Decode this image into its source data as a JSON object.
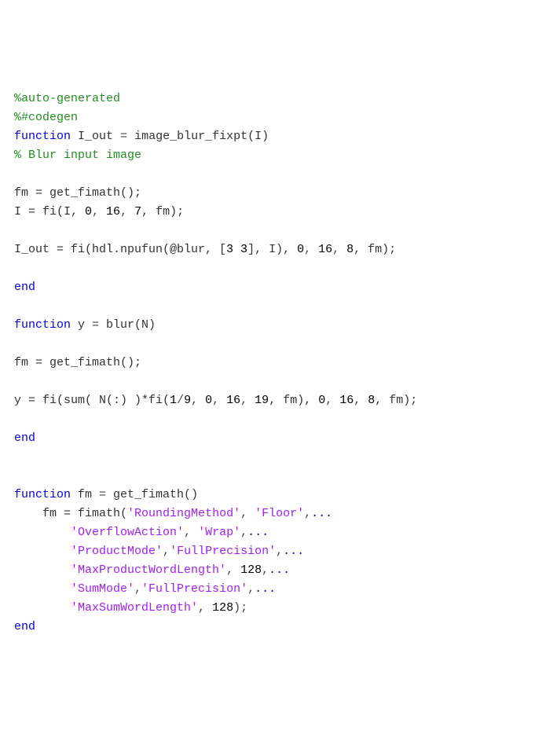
{
  "code": {
    "l01": {
      "comment": "%auto-generated"
    },
    "l02": {
      "comment": "%#codegen"
    },
    "l03": {
      "kw1": "function",
      "out": "I_out",
      "eq": " = ",
      "fn": "image_blur_fixpt(I)"
    },
    "l04": {
      "comment": "% Blur input image"
    },
    "l05": "",
    "l06": {
      "lhs": "fm = get_fimath();"
    },
    "l07": {
      "lhs": "I = fi(I, ",
      "n1": "0",
      "c1": ", ",
      "n2": "16",
      "c2": ", ",
      "n3": "7",
      "tail": ", fm);"
    },
    "l08": "",
    "l09": {
      "lhs": "I_out = fi(hdl.npufun(@blur, [",
      "n1": "3 3",
      "mid": "], I), ",
      "n2": "0",
      "c1": ", ",
      "n3": "16",
      "c2": ", ",
      "n4": "8",
      "tail": ", fm);"
    },
    "l10": "",
    "l11": {
      "kw": "end"
    },
    "l12": "",
    "l13": {
      "kw1": "function",
      "out": " y",
      "eq": " = ",
      "fn": "blur(N)"
    },
    "l14": "",
    "l15": {
      "lhs": "fm = get_fimath();"
    },
    "l16": "",
    "l17": {
      "lhs": "y = fi(sum( N(:) )*fi(",
      "n1": "1",
      "slash": "/",
      "n2": "9",
      "c1": ", ",
      "n3": "0",
      "c2": ", ",
      "n4": "16",
      "c3": ", ",
      "n5": "19",
      "mid": ", fm), ",
      "n6": "0",
      "c4": ", ",
      "n7": "16",
      "c5": ", ",
      "n8": "8",
      "tail": ", fm);"
    },
    "l18": "",
    "l19": {
      "kw": "end"
    },
    "l20": "",
    "l21": "",
    "l22": {
      "kw1": "function",
      "out": " fm",
      "eq": " = ",
      "fn": "get_fimath()"
    },
    "l23": {
      "indent": "    ",
      "lhs": "fm = fimath(",
      "s1": "'RoundingMethod'",
      "c1": ", ",
      "s2": "'Floor'",
      "tail": ",",
      "kdots": "..."
    },
    "l24": {
      "indent": "        ",
      "s1": "'OverflowAction'",
      "c1": ", ",
      "s2": "'Wrap'",
      "tail": ",",
      "kdots": "..."
    },
    "l25": {
      "indent": "        ",
      "s1": "'ProductMode'",
      "c1": ",",
      "s2": "'FullPrecision'",
      "tail": ",",
      "kdots": "..."
    },
    "l26": {
      "indent": "        ",
      "s1": "'MaxProductWordLength'",
      "c1": ", ",
      "n1": "128",
      "tail": ",",
      "kdots": "..."
    },
    "l27": {
      "indent": "        ",
      "s1": "'SumMode'",
      "c1": ",",
      "s2": "'FullPrecision'",
      "tail": ",",
      "kdots": "..."
    },
    "l28": {
      "indent": "        ",
      "s1": "'MaxSumWordLength'",
      "c1": ", ",
      "n1": "128",
      "tail": ");"
    },
    "l29": {
      "kw": "end"
    }
  }
}
